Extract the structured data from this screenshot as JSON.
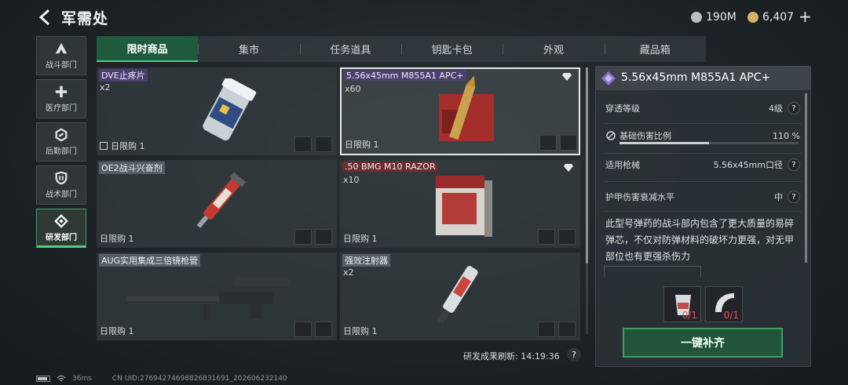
{
  "header": {
    "title": "军需处",
    "currencies": [
      {
        "name": "silver",
        "amount": "190M",
        "color": "#b9bec0"
      },
      {
        "name": "gold",
        "amount": "6,407",
        "color": "#d4b06a"
      }
    ],
    "plus_label": "+"
  },
  "sidebar": {
    "items": [
      {
        "label": "战斗部门",
        "icon": "combat-icon",
        "active": false
      },
      {
        "label": "医疗部门",
        "icon": "medical-cross-icon",
        "active": false
      },
      {
        "label": "后勤部门",
        "icon": "logistics-icon",
        "active": false
      },
      {
        "label": "战术部门",
        "icon": "shield-icon",
        "active": false
      },
      {
        "label": "研发部门",
        "icon": "research-icon",
        "active": true
      }
    ]
  },
  "tabs": [
    {
      "label": "限时商品",
      "active": true
    },
    {
      "label": "集市",
      "active": false
    },
    {
      "label": "任务道具",
      "active": false
    },
    {
      "label": "钥匙卡包",
      "active": false
    },
    {
      "label": "外观",
      "active": false
    },
    {
      "label": "藏品箱",
      "active": false
    }
  ],
  "items": [
    {
      "name": "DVE止疼片",
      "count": "x2",
      "limit": "日限购 1",
      "tag": "purple"
    },
    {
      "name": "5.56x45mm M855A1 APC+",
      "count": "x60",
      "limit": "日限购 1",
      "tag": "purple"
    },
    {
      "name": "OE2战斗兴奋剂",
      "count": "",
      "limit": "日限购 1",
      "tag": "grey"
    },
    {
      "name": ".50 BMG M10 RAZOR",
      "count": "x10",
      "limit": "日限购 1",
      "tag": "red"
    },
    {
      "name": "AUG实用集成三倍镜枪管",
      "count": "",
      "limit": "日限购 1",
      "tag": "grey"
    },
    {
      "name": "强效注射器",
      "count": "x2",
      "limit": "日限购 1",
      "tag": "grey"
    }
  ],
  "refresh": {
    "label": "研发成果刷新: 14:19:36",
    "help": "?"
  },
  "detail": {
    "title": "5.56x45mm M855A1 APC+",
    "stats": [
      {
        "label": "穿透等级",
        "value": "4级"
      },
      {
        "label": "基础伤害比例",
        "value": "110 %",
        "bar_fill": 0.5
      },
      {
        "label": "适用枪械",
        "value": "5.56x45mm口径"
      },
      {
        "label": "护甲伤害衰减水平",
        "value": "中"
      }
    ],
    "description": "此型号弹药的战斗部内包含了更大质量的易碎弹芯，不仅对防弹材料的破坏力更强，对无甲部位也有更强杀伤力",
    "requirements": [
      {
        "item": "cup-icon",
        "count": "0/1"
      },
      {
        "item": "armor-plate-icon",
        "count": "0/1"
      }
    ],
    "buy_label": "一键补齐"
  },
  "footer": {
    "ping": "36ms",
    "uid": "CN UID:276942746988268316​91_202606232140"
  }
}
